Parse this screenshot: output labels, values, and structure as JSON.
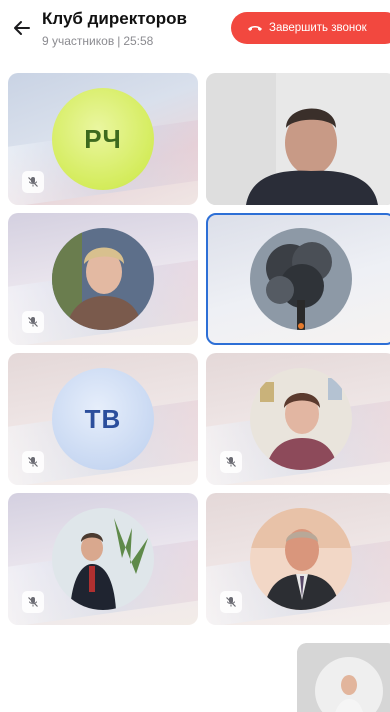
{
  "header": {
    "title": "Клуб директоров",
    "participants": "9 участников",
    "separator": "|",
    "duration": "25:58",
    "end_call_label": "Завершить звонок"
  },
  "icons": {
    "back": "arrow-left-icon",
    "end_call": "phone-hangup-icon",
    "mic_off": "mic-off-icon"
  },
  "colors": {
    "end_call_bg": "#f2483f",
    "selected_border": "#2d6fd6",
    "rch_avatar": "#d4ec5c",
    "tv_avatar": "#c8d8f2"
  },
  "participants": [
    {
      "initials": "РЧ",
      "muted": true
    },
    {
      "initials": "",
      "video_on": true
    },
    {
      "initials": "",
      "muted": true
    },
    {
      "initials": "",
      "selected": true
    },
    {
      "initials": "ТВ",
      "muted": true
    },
    {
      "initials": "",
      "muted": true
    },
    {
      "initials": "",
      "muted": true
    },
    {
      "initials": "",
      "muted": true
    }
  ]
}
